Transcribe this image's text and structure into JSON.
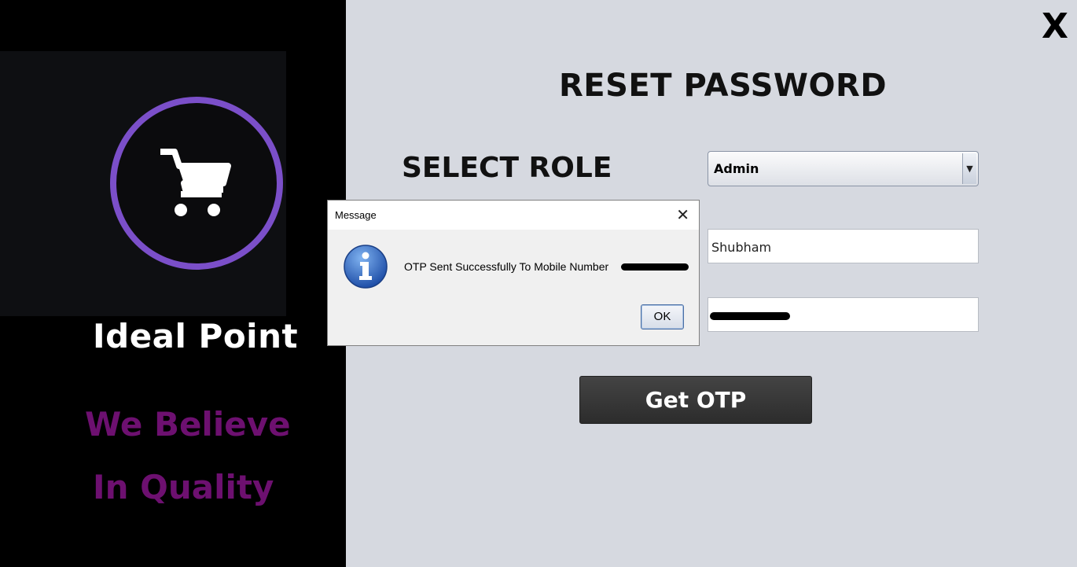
{
  "brand": {
    "name": "Ideal Point",
    "tagline_line1": "We Believe",
    "tagline_line2": "In Quality"
  },
  "window": {
    "close_label": "X"
  },
  "form": {
    "title": "RESET PASSWORD",
    "role_label": "SELECT ROLE",
    "role_selected": "Admin",
    "username_value": "Shubham",
    "submit_label": "Get OTP"
  },
  "dialog": {
    "title": "Message",
    "message": "OTP Sent Successfully To Mobile Number",
    "ok_label": "OK"
  },
  "colors": {
    "accent_ring": "#7b4fc9",
    "tagline": "#6d1070",
    "panel_bg": "#d6d9e0"
  }
}
